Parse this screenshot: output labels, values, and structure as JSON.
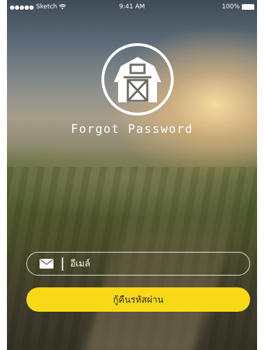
{
  "status_bar": {
    "carrier": "Sketch",
    "time": "9:41 AM",
    "battery": "100%"
  },
  "logo": {
    "icon": "barn-icon"
  },
  "title": "Forgot Password",
  "email_field": {
    "icon": "mail-icon",
    "placeholder": "อีเมล์",
    "value": ""
  },
  "recover_button": {
    "label": "กู้คืนรหัสผ่าน"
  },
  "colors": {
    "accent": "#f7d917",
    "text": "#ffffff"
  }
}
